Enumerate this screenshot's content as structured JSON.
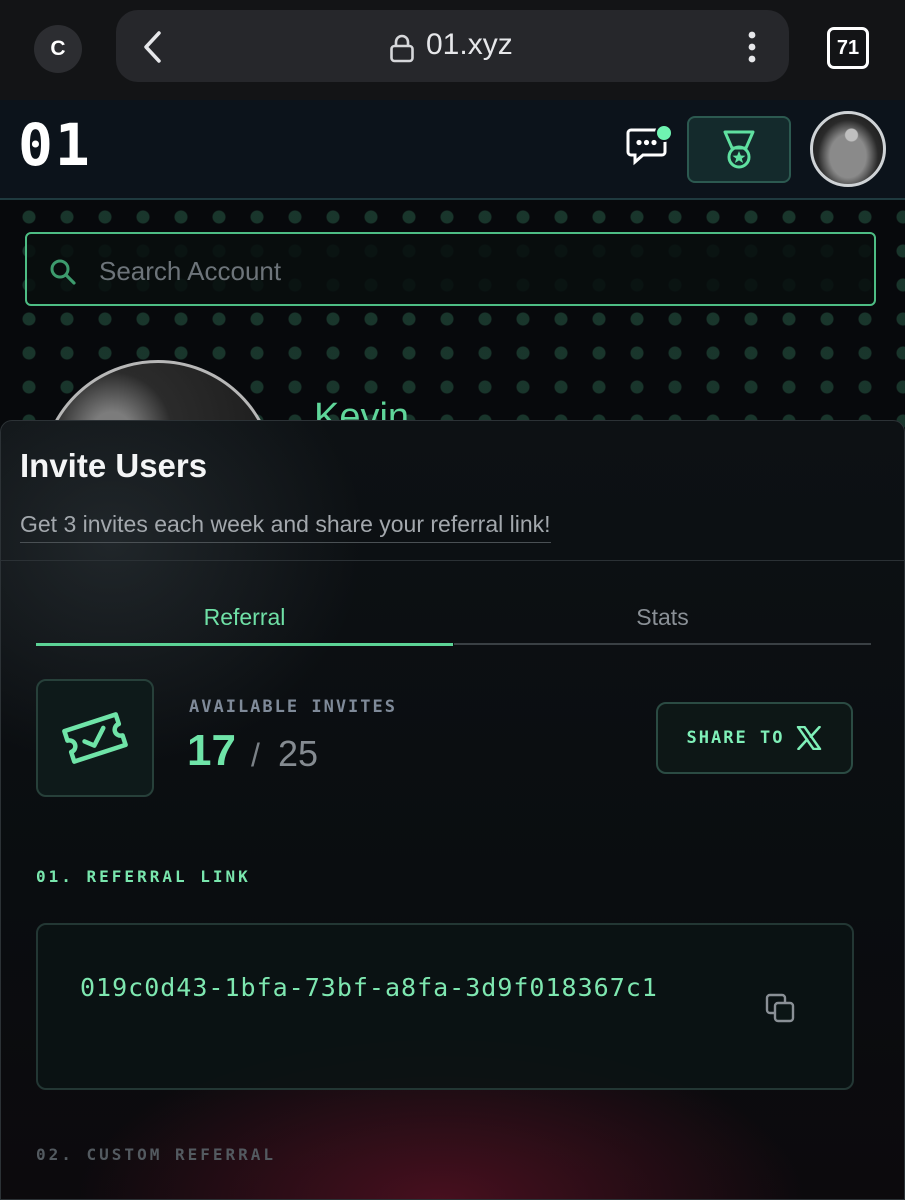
{
  "browser": {
    "badge": "C",
    "url": "01.xyz",
    "tab_count": "71"
  },
  "header": {
    "logo": "01"
  },
  "search": {
    "placeholder": "Search Account",
    "value": ""
  },
  "profile": {
    "name_partial": "Kevin"
  },
  "modal": {
    "title": "Invite Users",
    "subtitle": "Get 3 invites each week and share your referral link!",
    "tabs": [
      {
        "label": "Referral",
        "active": true
      },
      {
        "label": "Stats",
        "active": false
      }
    ],
    "invites": {
      "label": "AVAILABLE INVITES",
      "available": "17",
      "separator": "/",
      "total": "25"
    },
    "share_button": {
      "label": "SHARE TO"
    },
    "referral_link": {
      "section_label": "01. REFERRAL LINK",
      "value": "019c0d43-1bfa-73bf-a8fa-3d9f018367c1"
    },
    "custom_referral": {
      "section_label": "02. CUSTOM REFERRAL"
    }
  },
  "colors": {
    "accent": "#6fe4a8",
    "background": "#0a0d10",
    "border": "#2b4b43"
  },
  "icons": {
    "back": "chevron-left-icon",
    "lock": "lock-icon",
    "menu": "kebab-menu-icon",
    "chat": "chat-bubble-icon",
    "medal": "medal-icon",
    "search": "search-icon",
    "ticket": "ticket-check-icon",
    "x_logo": "x-logo-icon",
    "copy": "copy-icon"
  }
}
